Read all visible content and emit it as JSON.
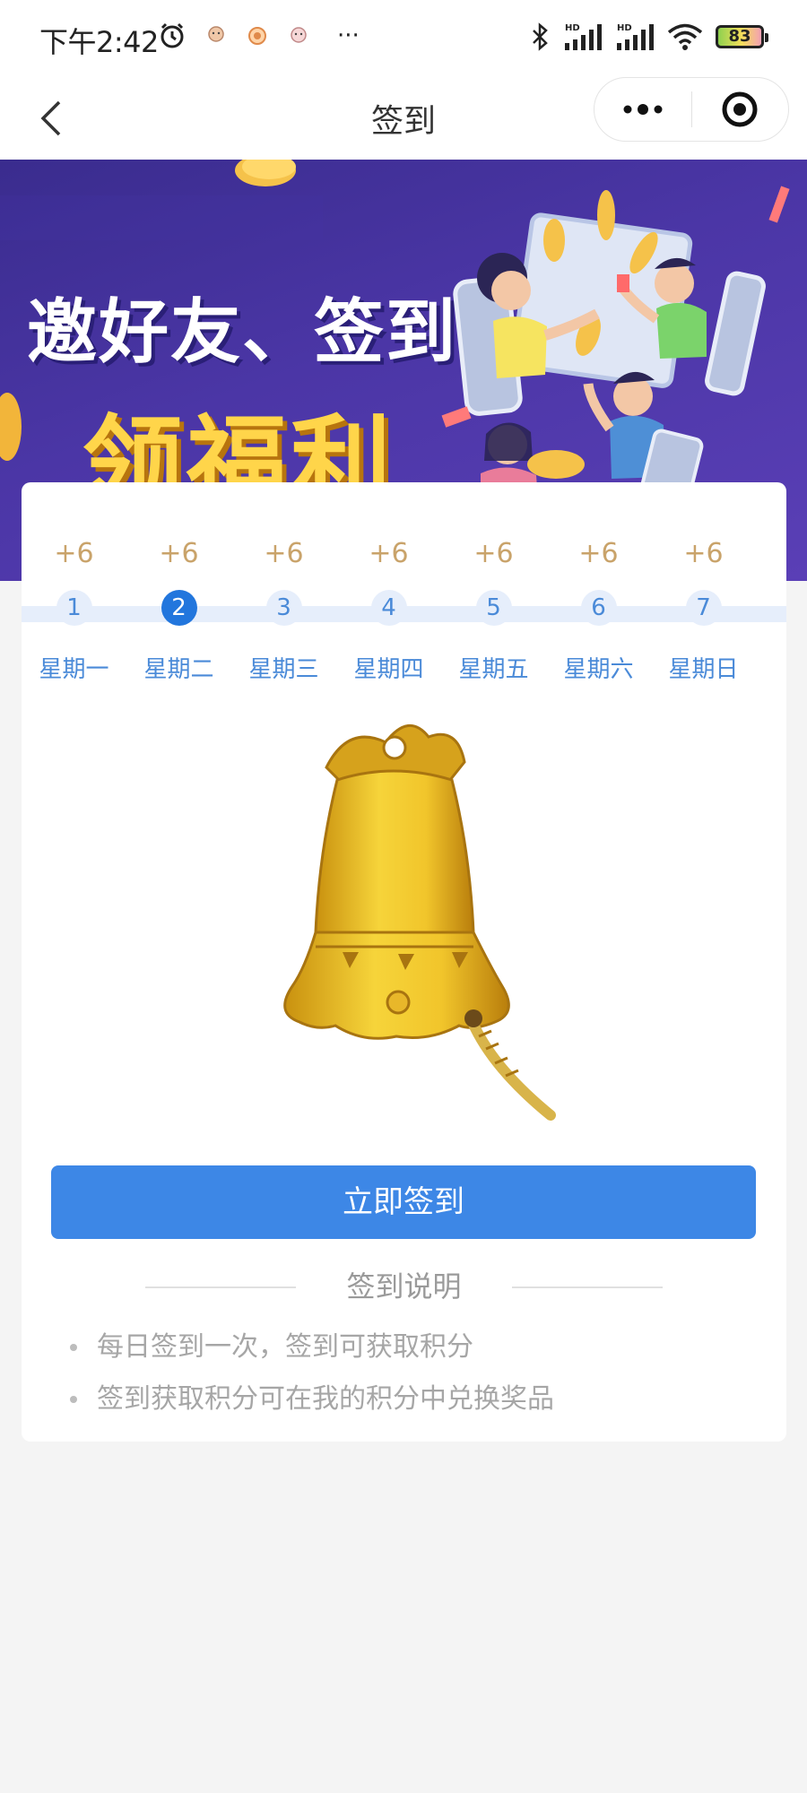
{
  "status_bar": {
    "time": "下午2:42",
    "more_indicator": "···",
    "battery_level": "83",
    "icons": [
      "alarm-icon",
      "notification-icon",
      "notification-icon",
      "notification-icon",
      "bluetooth-icon",
      "signal-hd-icon",
      "signal-hd-icon",
      "wifi-icon",
      "battery-icon"
    ]
  },
  "nav": {
    "title": "签到",
    "back_icon": "chevron-left-icon",
    "menu_icon": "more-dots-icon",
    "close_icon": "target-icon"
  },
  "banner": {
    "line1": "邀好友、签到",
    "line2": "领福利"
  },
  "week": {
    "days": [
      {
        "points": "+6",
        "number": "1",
        "label": "星期一",
        "active": false
      },
      {
        "points": "+6",
        "number": "2",
        "label": "星期二",
        "active": true
      },
      {
        "points": "+6",
        "number": "3",
        "label": "星期三",
        "active": false
      },
      {
        "points": "+6",
        "number": "4",
        "label": "星期四",
        "active": false
      },
      {
        "points": "+6",
        "number": "5",
        "label": "星期五",
        "active": false
      },
      {
        "points": "+6",
        "number": "6",
        "label": "星期六",
        "active": false
      },
      {
        "points": "+6",
        "number": "7",
        "label": "星期日",
        "active": false
      }
    ]
  },
  "signin_button": "立即签到",
  "notes": {
    "title": "签到说明",
    "items": [
      "每日签到一次，签到可获取积分",
      "签到获取积分可在我的积分中兑换奖品"
    ]
  },
  "colors": {
    "accent": "#3d87e6",
    "active_day": "#2276dd",
    "points": "#c9a36a",
    "banner_bg": "#4b36a6",
    "banner_highlight": "#ffd54a"
  }
}
